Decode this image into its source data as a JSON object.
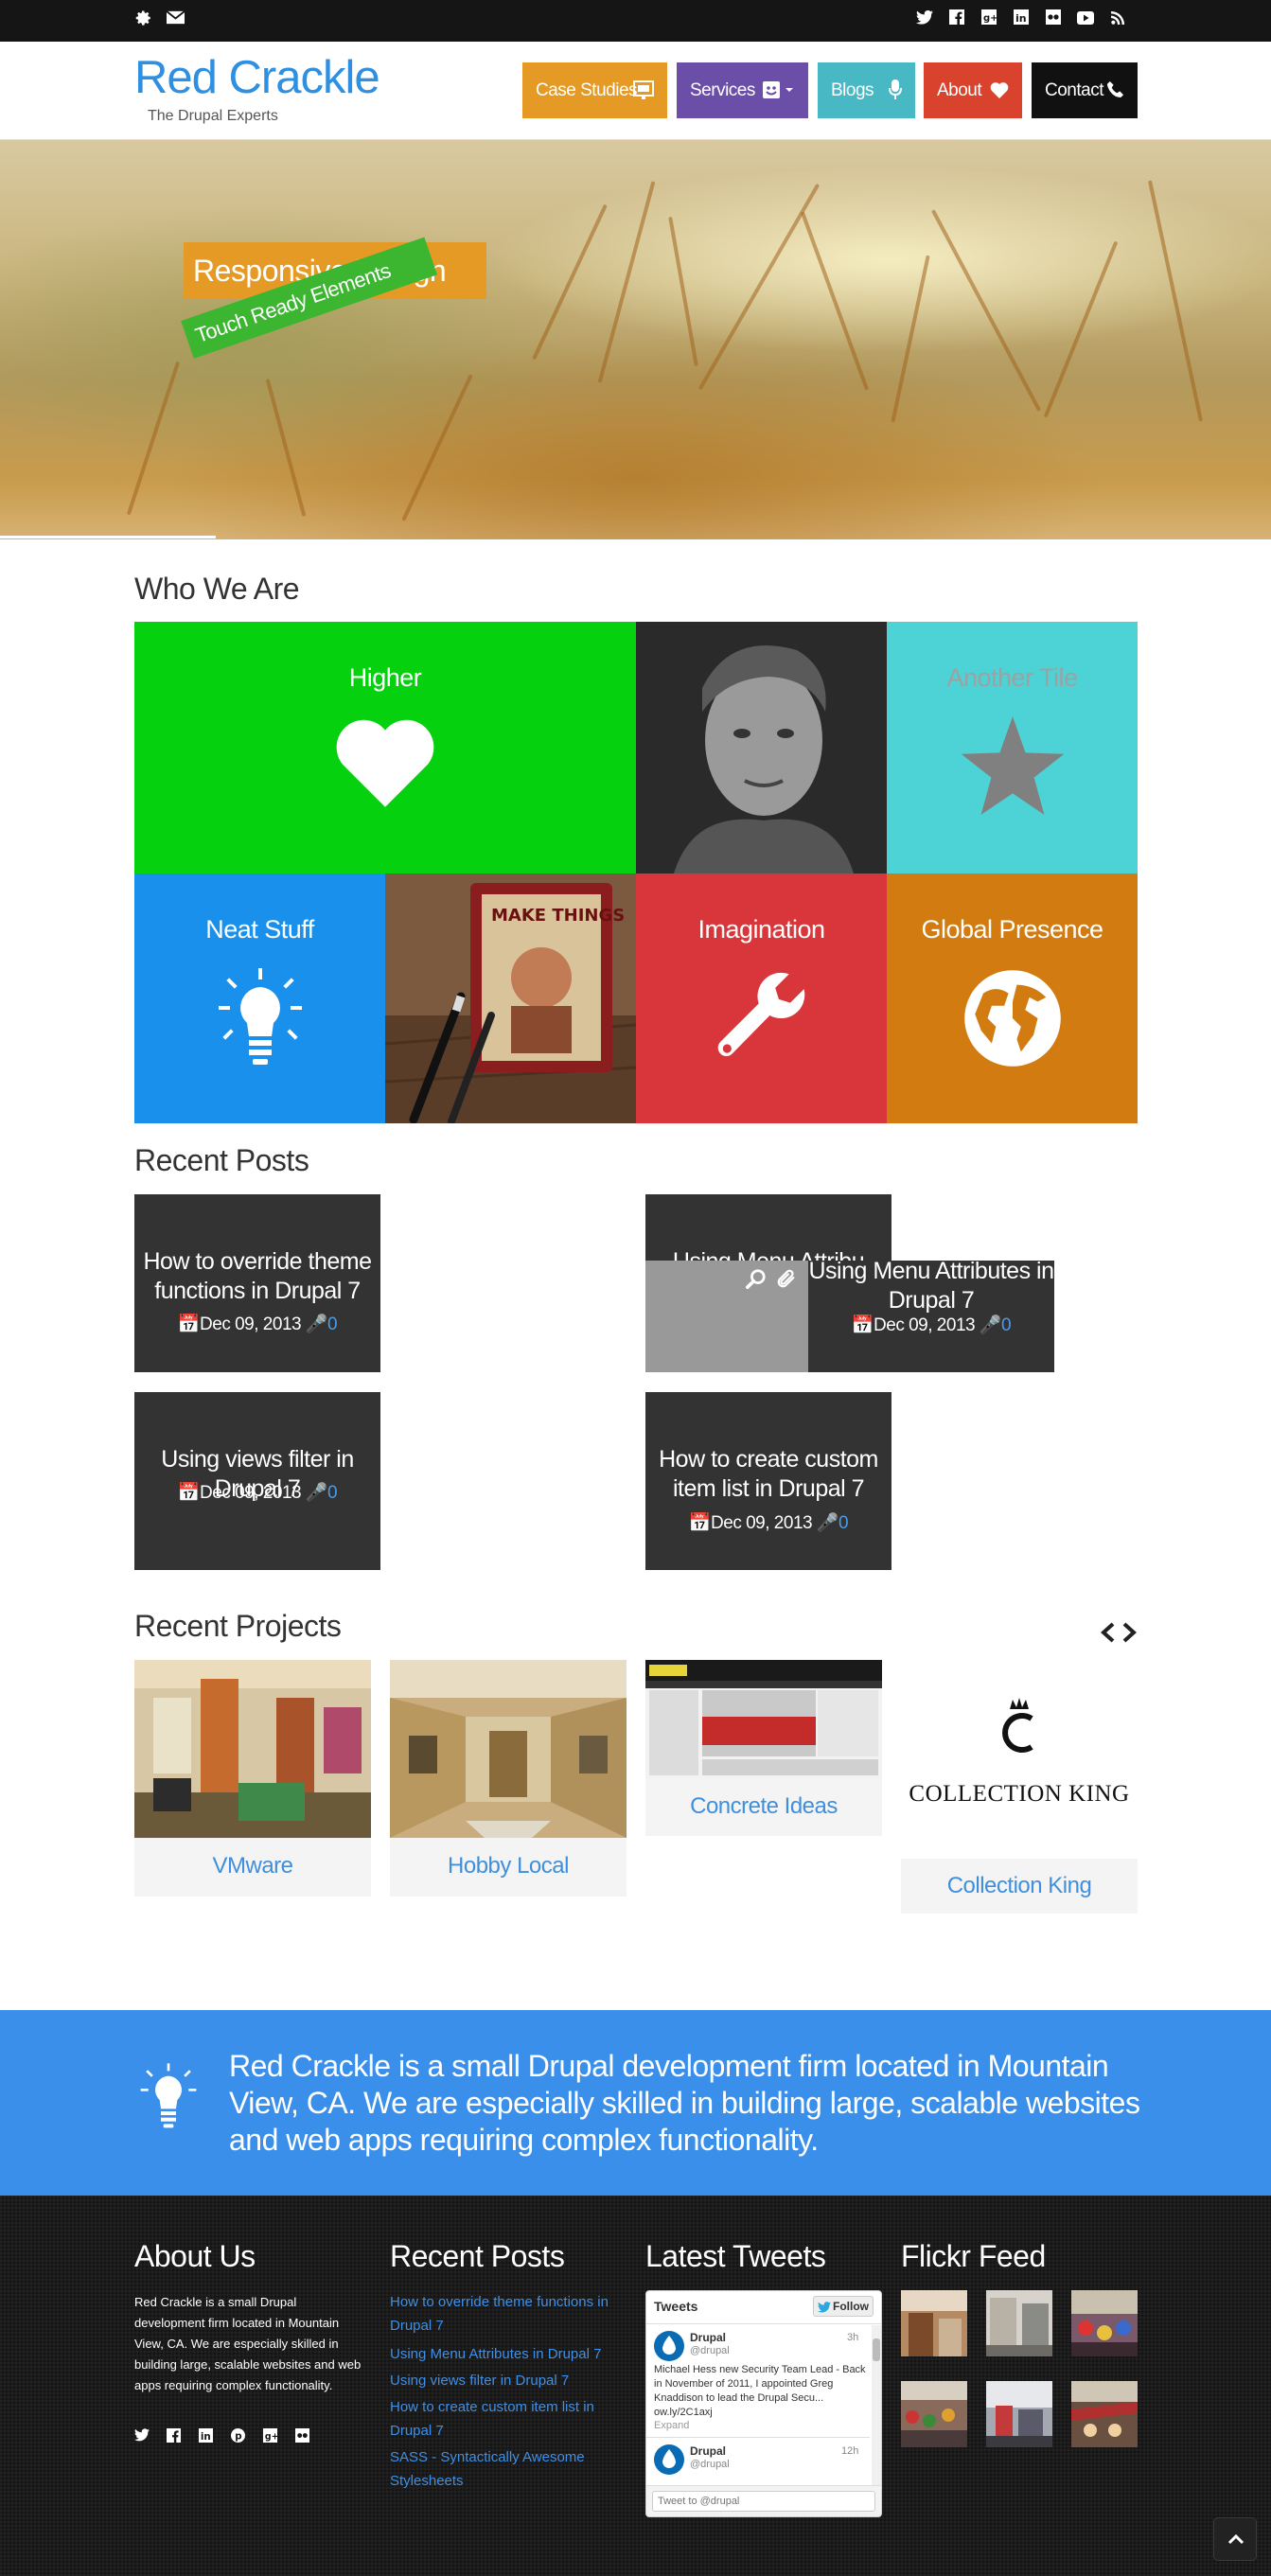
{
  "topbar": {
    "left_icons": [
      "gear-icon",
      "envelope-icon"
    ],
    "social_icons": [
      "twitter-icon",
      "facebook-icon",
      "google-plus-icon",
      "linkedin-icon",
      "flickr-icon",
      "youtube-icon",
      "rss-icon"
    ]
  },
  "header": {
    "logo_title": "Red Crackle",
    "logo_subtitle": "The Drupal Experts",
    "nav": [
      {
        "label": "Case Studies",
        "icon": "presentation-icon",
        "color": "#e49a25"
      },
      {
        "label": "Services",
        "icon": "smiley-icon",
        "color": "#6a4ea8"
      },
      {
        "label": "Blogs",
        "icon": "microphone-icon",
        "color": "#48b8c4"
      },
      {
        "label": "About",
        "icon": "heart-icon",
        "color": "#d9432e"
      },
      {
        "label": "Contact",
        "icon": "phone-icon",
        "color": "#111111"
      }
    ]
  },
  "hero": {
    "title": "Responsive Design",
    "badge": "Touch Ready Elements"
  },
  "who_we_are": {
    "title": "Who We Are",
    "tiles": [
      {
        "label": "Higher",
        "icon": "heart-icon",
        "color": "#05d10f"
      },
      {
        "label": "Another Tile",
        "icon": "star-icon",
        "color": "#4dd3d6"
      },
      {
        "label": "Neat Stuff",
        "icon": "lightbulb-icon",
        "color": "#1a90ed"
      },
      {
        "label": "Imagination",
        "icon": "wrench-icon",
        "color": "#d8363a"
      },
      {
        "label": "Global Presence",
        "icon": "globe-icon",
        "color": "#d27b10"
      }
    ]
  },
  "recent_posts": {
    "title": "Recent Posts",
    "posts": [
      {
        "title": "How to override theme functions in Drupal 7",
        "date": "Dec 09, 2013",
        "comments": "0"
      },
      {
        "title": "Using Menu Attributes in Drupal 7",
        "date": "Dec 09, 2013",
        "comments": "0",
        "overlap_title": "Using Menu Attribu"
      },
      {
        "title": "Using views filter in Drupal 7",
        "date": "Dec 09, 2013",
        "comments": "0"
      },
      {
        "title": "How to create custom item list in Drupal 7",
        "date": "Dec 09, 2013",
        "comments": "0"
      }
    ]
  },
  "recent_projects": {
    "title": "Recent Projects",
    "projects": [
      {
        "label": "VMware"
      },
      {
        "label": "Hobby Local"
      },
      {
        "label": "Concrete Ideas"
      },
      {
        "label": "Collection King",
        "logo_text": "COLLECTION KING"
      }
    ]
  },
  "band": {
    "text": "Red Crackle is a small Drupal development firm located in Mountain View, CA. We are especially skilled in building large, scalable websites and web apps requiring complex functionality."
  },
  "footer": {
    "about_title": "About Us",
    "about_text": "Red Crackle is a small Drupal development firm located in Mountain View, CA. We are especially skilled in building large, scalable websites and web apps requiring complex functionality.",
    "about_social": [
      "twitter-icon",
      "facebook-icon",
      "linkedin-icon",
      "pinterest-icon",
      "google-plus-icon",
      "flickr-icon"
    ],
    "recent_posts_title": "Recent Posts",
    "recent_post_links": [
      "How to override theme functions in Drupal 7",
      "Using Menu Attributes in Drupal 7",
      "Using views filter in Drupal 7",
      "How to create custom item list in Drupal 7",
      "SASS - Syntactically Awesome Stylesheets"
    ],
    "tweets_title": "Latest Tweets",
    "tweets_widget": {
      "header": "Tweets",
      "follow": "Follow",
      "tweets": [
        {
          "name": "Drupal",
          "handle": "@drupal",
          "time": "3h",
          "text": "Michael Hess new Security Team Lead - Back in November of 2011, I appointed Greg Knaddison to lead the Drupal Secu... ow.ly/2C1axj",
          "expand": "Expand"
        },
        {
          "name": "Drupal",
          "handle": "@drupal",
          "time": "12h"
        }
      ],
      "compose_placeholder": "Tweet to @drupal"
    },
    "flickr_title": "Flickr Feed"
  }
}
